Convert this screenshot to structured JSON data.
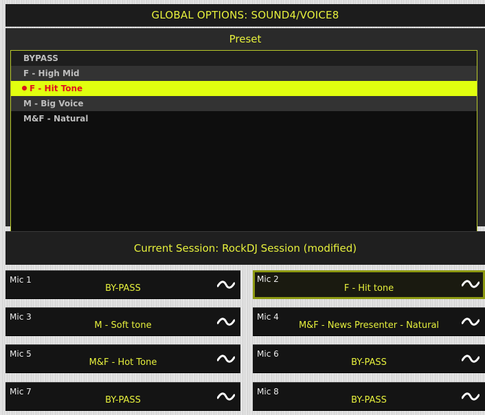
{
  "header": {
    "title": "GLOBAL OPTIONS: SOUND4/VOICE8"
  },
  "preset": {
    "title": "Preset",
    "items": [
      {
        "label": "BYPASS"
      },
      {
        "label": "F - High Mid"
      },
      {
        "label": "F - Hit Tone",
        "selected": true
      },
      {
        "label": "M - Big Voice"
      },
      {
        "label": "M&F - Natural"
      }
    ]
  },
  "session": {
    "label": "Current Session: RockDJ  Session (modified)"
  },
  "mics": [
    {
      "name": "Mic 1",
      "value": "BY-PASS"
    },
    {
      "name": "Mic 2",
      "value": "F - Hit tone",
      "selected": true
    },
    {
      "name": "Mic 3",
      "value": "M - Soft tone"
    },
    {
      "name": "Mic 4",
      "value": "M&F - News Presenter - Natural"
    },
    {
      "name": "Mic 5",
      "value": "M&F - Hot Tone"
    },
    {
      "name": "Mic 6",
      "value": "BY-PASS"
    },
    {
      "name": "Mic 7",
      "value": "BY-PASS"
    },
    {
      "name": "Mic 8",
      "value": "BY-PASS"
    }
  ],
  "colors": {
    "accent": "#e6f03c",
    "selection": "#e1ff0f",
    "selected_text": "#e0141e"
  },
  "icons": {
    "preset_marker": "selected-dot-icon",
    "mic_dropdown": "wave-dropdown-icon"
  }
}
